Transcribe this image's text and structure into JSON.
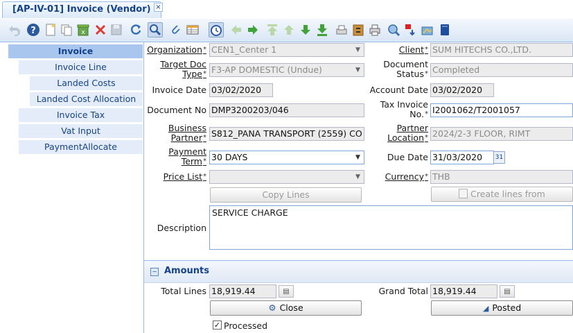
{
  "tab": {
    "title": "[AP-IV-01] Invoice (Vendor)",
    "close": "×"
  },
  "nav": [
    "Invoice",
    "Invoice Line",
    "Landed Costs",
    "Landed Cost Allocation",
    "Invoice Tax",
    "Vat Input",
    "PaymentAllocate"
  ],
  "labels": {
    "organization": "Organization",
    "target_doc_type_1": "Target Doc",
    "target_doc_type_2": "Type",
    "invoice_date": "Invoice Date",
    "document_no": "Document No",
    "business_partner_1": "Business",
    "business_partner_2": "Partner",
    "payment_term_1": "Payment",
    "payment_term_2": "Term",
    "price_list": "Price List",
    "description": "Description",
    "client": "Client",
    "document_status_1": "Document",
    "document_status_2": "Status",
    "account_date": "Account Date",
    "tax_invoice_no_1": "Tax Invoice",
    "tax_invoice_no_2": "No.",
    "partner_location_1": "Partner",
    "partner_location_2": "Location",
    "due_date": "Due Date",
    "currency": "Currency",
    "total_lines": "Total Lines",
    "grand_total": "Grand Total",
    "required": "*"
  },
  "values": {
    "organization": "CEN1_Center 1",
    "target_doc_type": "F3-AP DOMESTIC (Undue)",
    "invoice_date": "03/02/2020",
    "document_no": "DMP3200203/046",
    "business_partner": "S812_PANA TRANSPORT (2559)  CO",
    "payment_term": "30 DAYS",
    "price_list": "",
    "client": "SUM HITECHS CO.,LTD.",
    "document_status": "Completed",
    "account_date": "03/02/2020",
    "tax_invoice_no": "I2001062/T2001057",
    "partner_location": "2024/2-3 FLOOR, RIMT",
    "due_date": "31/03/2020",
    "currency": "THB",
    "description": "SERVICE CHARGE",
    "total_lines": "18,919.44",
    "grand_total": "18,919.44"
  },
  "buttons": {
    "copy_lines": "Copy Lines",
    "create_lines_from": "Create lines from",
    "close": "Close",
    "posted": "Posted"
  },
  "section": {
    "amounts": "Amounts"
  },
  "checkbox": {
    "processed": "Processed",
    "processed_checked": true
  },
  "toolbar_icons": [
    "undo-icon",
    "help-icon",
    "new-record-icon",
    "copy-record-icon",
    "delete-selection-icon",
    "delete-icon",
    "save-icon",
    "refresh-icon",
    "find-icon",
    "attachment-icon",
    "grid-toggle-icon",
    "history-icon",
    "previous-parent-icon",
    "next-parent-icon",
    "first-record-icon",
    "previous-record-icon",
    "next-record-icon",
    "last-record-icon",
    "report-icon",
    "archive-icon",
    "print-icon",
    "zoom-across-icon",
    "request-icon",
    "product-info-icon",
    "workflow-icon"
  ]
}
